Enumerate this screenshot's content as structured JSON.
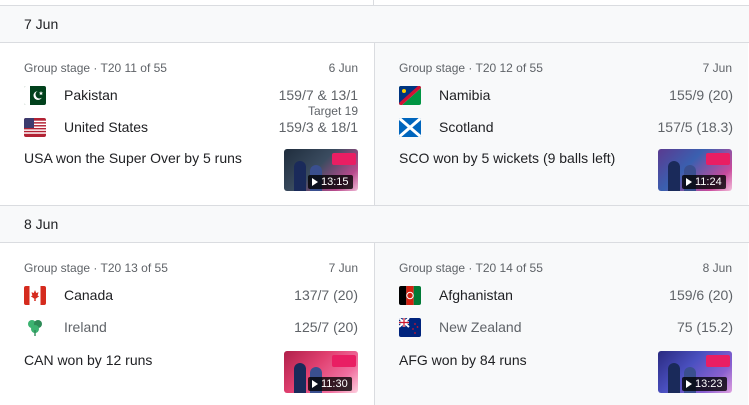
{
  "groups": [
    {
      "date_label": "7 Jun",
      "matches": [
        {
          "stage": "Group stage · T20 11 of 55",
          "date": "6 Jun",
          "team1": {
            "name": "Pakistan",
            "score": "159/7 & 13/1",
            "flag": "pakistan-flag-icon"
          },
          "target": "Target 19",
          "team2": {
            "name": "United States",
            "score": "159/3 & 18/1",
            "flag": "usa-flag-icon"
          },
          "result": "USA won the Super Over by 5 runs",
          "video_duration": "13:15"
        },
        {
          "stage": "Group stage · T20 12 of 55",
          "date": "7 Jun",
          "team1": {
            "name": "Namibia",
            "score": "155/9 (20)",
            "flag": "namibia-flag-icon"
          },
          "team2": {
            "name": "Scotland",
            "score": "157/5 (18.3)",
            "flag": "scotland-flag-icon"
          },
          "result": "SCO won by 5 wickets (9 balls left)",
          "video_duration": "11:24"
        }
      ]
    },
    {
      "date_label": "8 Jun",
      "matches": [
        {
          "stage": "Group stage · T20 13 of 55",
          "date": "7 Jun",
          "team1": {
            "name": "Canada",
            "score": "137/7 (20)",
            "flag": "canada-flag-icon"
          },
          "team2": {
            "name": "Ireland",
            "score": "125/7 (20)",
            "flag": "ireland-cricket-icon"
          },
          "result": "CAN won by 12 runs",
          "video_duration": "11:30"
        },
        {
          "stage": "Group stage · T20 14 of 55",
          "date": "8 Jun",
          "team1": {
            "name": "Afghanistan",
            "score": "159/6 (20)",
            "flag": "afghanistan-flag-icon"
          },
          "team2": {
            "name": "New Zealand",
            "score": "75 (15.2)",
            "flag": "new-zealand-flag-icon"
          },
          "result": "AFG won by 84 runs",
          "video_duration": "13:23"
        }
      ]
    }
  ]
}
